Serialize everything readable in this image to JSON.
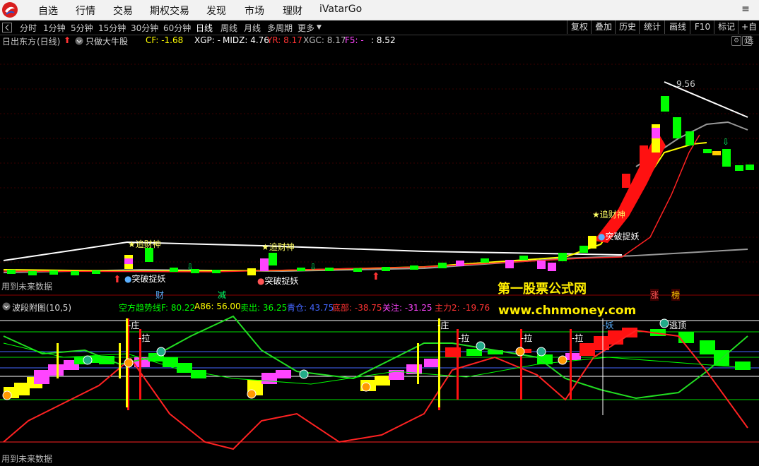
{
  "menu": [
    "自选",
    "行情",
    "交易",
    "期权交易",
    "发现",
    "市场",
    "理财",
    "iVatarGo"
  ],
  "periods": [
    "分时",
    "1分钟",
    "5分钟",
    "15分钟",
    "30分钟",
    "60分钟",
    "日线",
    "周线",
    "月线",
    "多周期",
    "更多"
  ],
  "tools": [
    "复权",
    "叠加",
    "历史",
    "统计",
    "画线",
    "F10",
    "标记",
    "+自选"
  ],
  "stock": {
    "name": "日出东方",
    "period": "(日线)",
    "indicator": "只做大牛股"
  },
  "info": [
    {
      "label": "CF: -1.68",
      "color": "#ffff00"
    },
    {
      "label": "XGP: -",
      "color": "#ffffff"
    },
    {
      "label": "MIDZ: 4.76",
      "color": "#ffffff"
    },
    {
      "label": "YR: 8.17",
      "color": "#ff3333"
    },
    {
      "label": "XGC: 8.17",
      "color": "#bbbbbb"
    },
    {
      "label": "F5: -",
      "color": "#ff44ff"
    },
    {
      "label": ": 8.52",
      "color": "#ffffff"
    }
  ],
  "main_chart": {
    "high_label": "9.56",
    "signals": [
      "追财神",
      "突破捉妖",
      "追财神",
      "突破捉妖",
      "追财神",
      "突破捉妖"
    ],
    "footnote": "用到未来数据",
    "bottom_tags": [
      "财",
      "减",
      "涨",
      "榜"
    ]
  },
  "watermark": {
    "line1": "第一股票公式网",
    "line2": "www.chnmoney.com"
  },
  "sub_chart": {
    "title": "波段附图(10,5)",
    "values": [
      {
        "label": "空方趋势线F: 80.22",
        "color": "#00ff00"
      },
      {
        "label": "A86: 56.00",
        "color": "#ffff00"
      },
      {
        "label": "卖出: 36.25",
        "color": "#00ff00"
      },
      {
        "label": "青仓: 43.75",
        "color": "#4466ff"
      },
      {
        "label": "底部: -38.75",
        "color": "#ff3333"
      },
      {
        "label": "关注: -31.25",
        "color": "#ff44ff"
      },
      {
        "label": "主力2: -19.76",
        "color": "#ff3333"
      }
    ],
    "markers": [
      "庄",
      "拉",
      "庄",
      "拉",
      "拉",
      "拉",
      "妖",
      "逃顶"
    ],
    "footnote": "用到未来数据"
  }
}
